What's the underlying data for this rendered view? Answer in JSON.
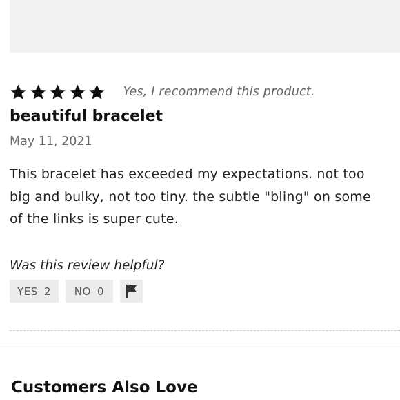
{
  "review": {
    "rating": 5,
    "rating_max": 5,
    "recommend_text": "Yes, I recommend this product.",
    "title": "beautiful bracelet",
    "date": "May 11, 2021",
    "body_lines": [
      "This bracelet has exceeded my expectations. not too",
      "big and bulky, not too tiny. the subtle \"bling\" on some",
      "of the links is super cute."
    ]
  },
  "helpful": {
    "question": "Was this review helpful?",
    "yes_label": "YES",
    "yes_count": "2",
    "no_label": "NO",
    "no_count": "0",
    "flag_icon": "flag-icon"
  },
  "section": {
    "title": "Customers Also Love"
  }
}
